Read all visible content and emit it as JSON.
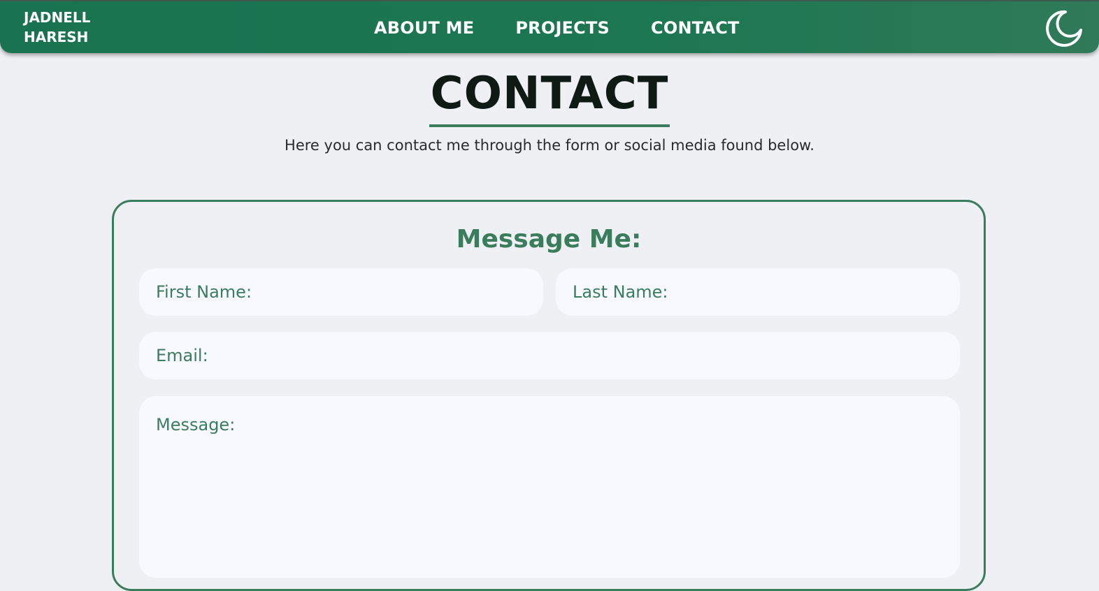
{
  "nav": {
    "brand_line1": "JADNELL",
    "brand_line2": "HARESH",
    "links": [
      {
        "label": "ABOUT ME"
      },
      {
        "label": "PROJECTS"
      },
      {
        "label": "CONTACT"
      }
    ],
    "theme_toggle_icon": "moon-icon",
    "accent_color": "#1d7752"
  },
  "page": {
    "title": "CONTACT",
    "subtitle": "Here you can contact me through the form or social media found below."
  },
  "form": {
    "heading": "Message Me:",
    "first_name_placeholder": "First Name:",
    "last_name_placeholder": "Last Name:",
    "email_placeholder": "Email:",
    "message_placeholder": "Message:",
    "accent_color": "#3a7d5c"
  }
}
